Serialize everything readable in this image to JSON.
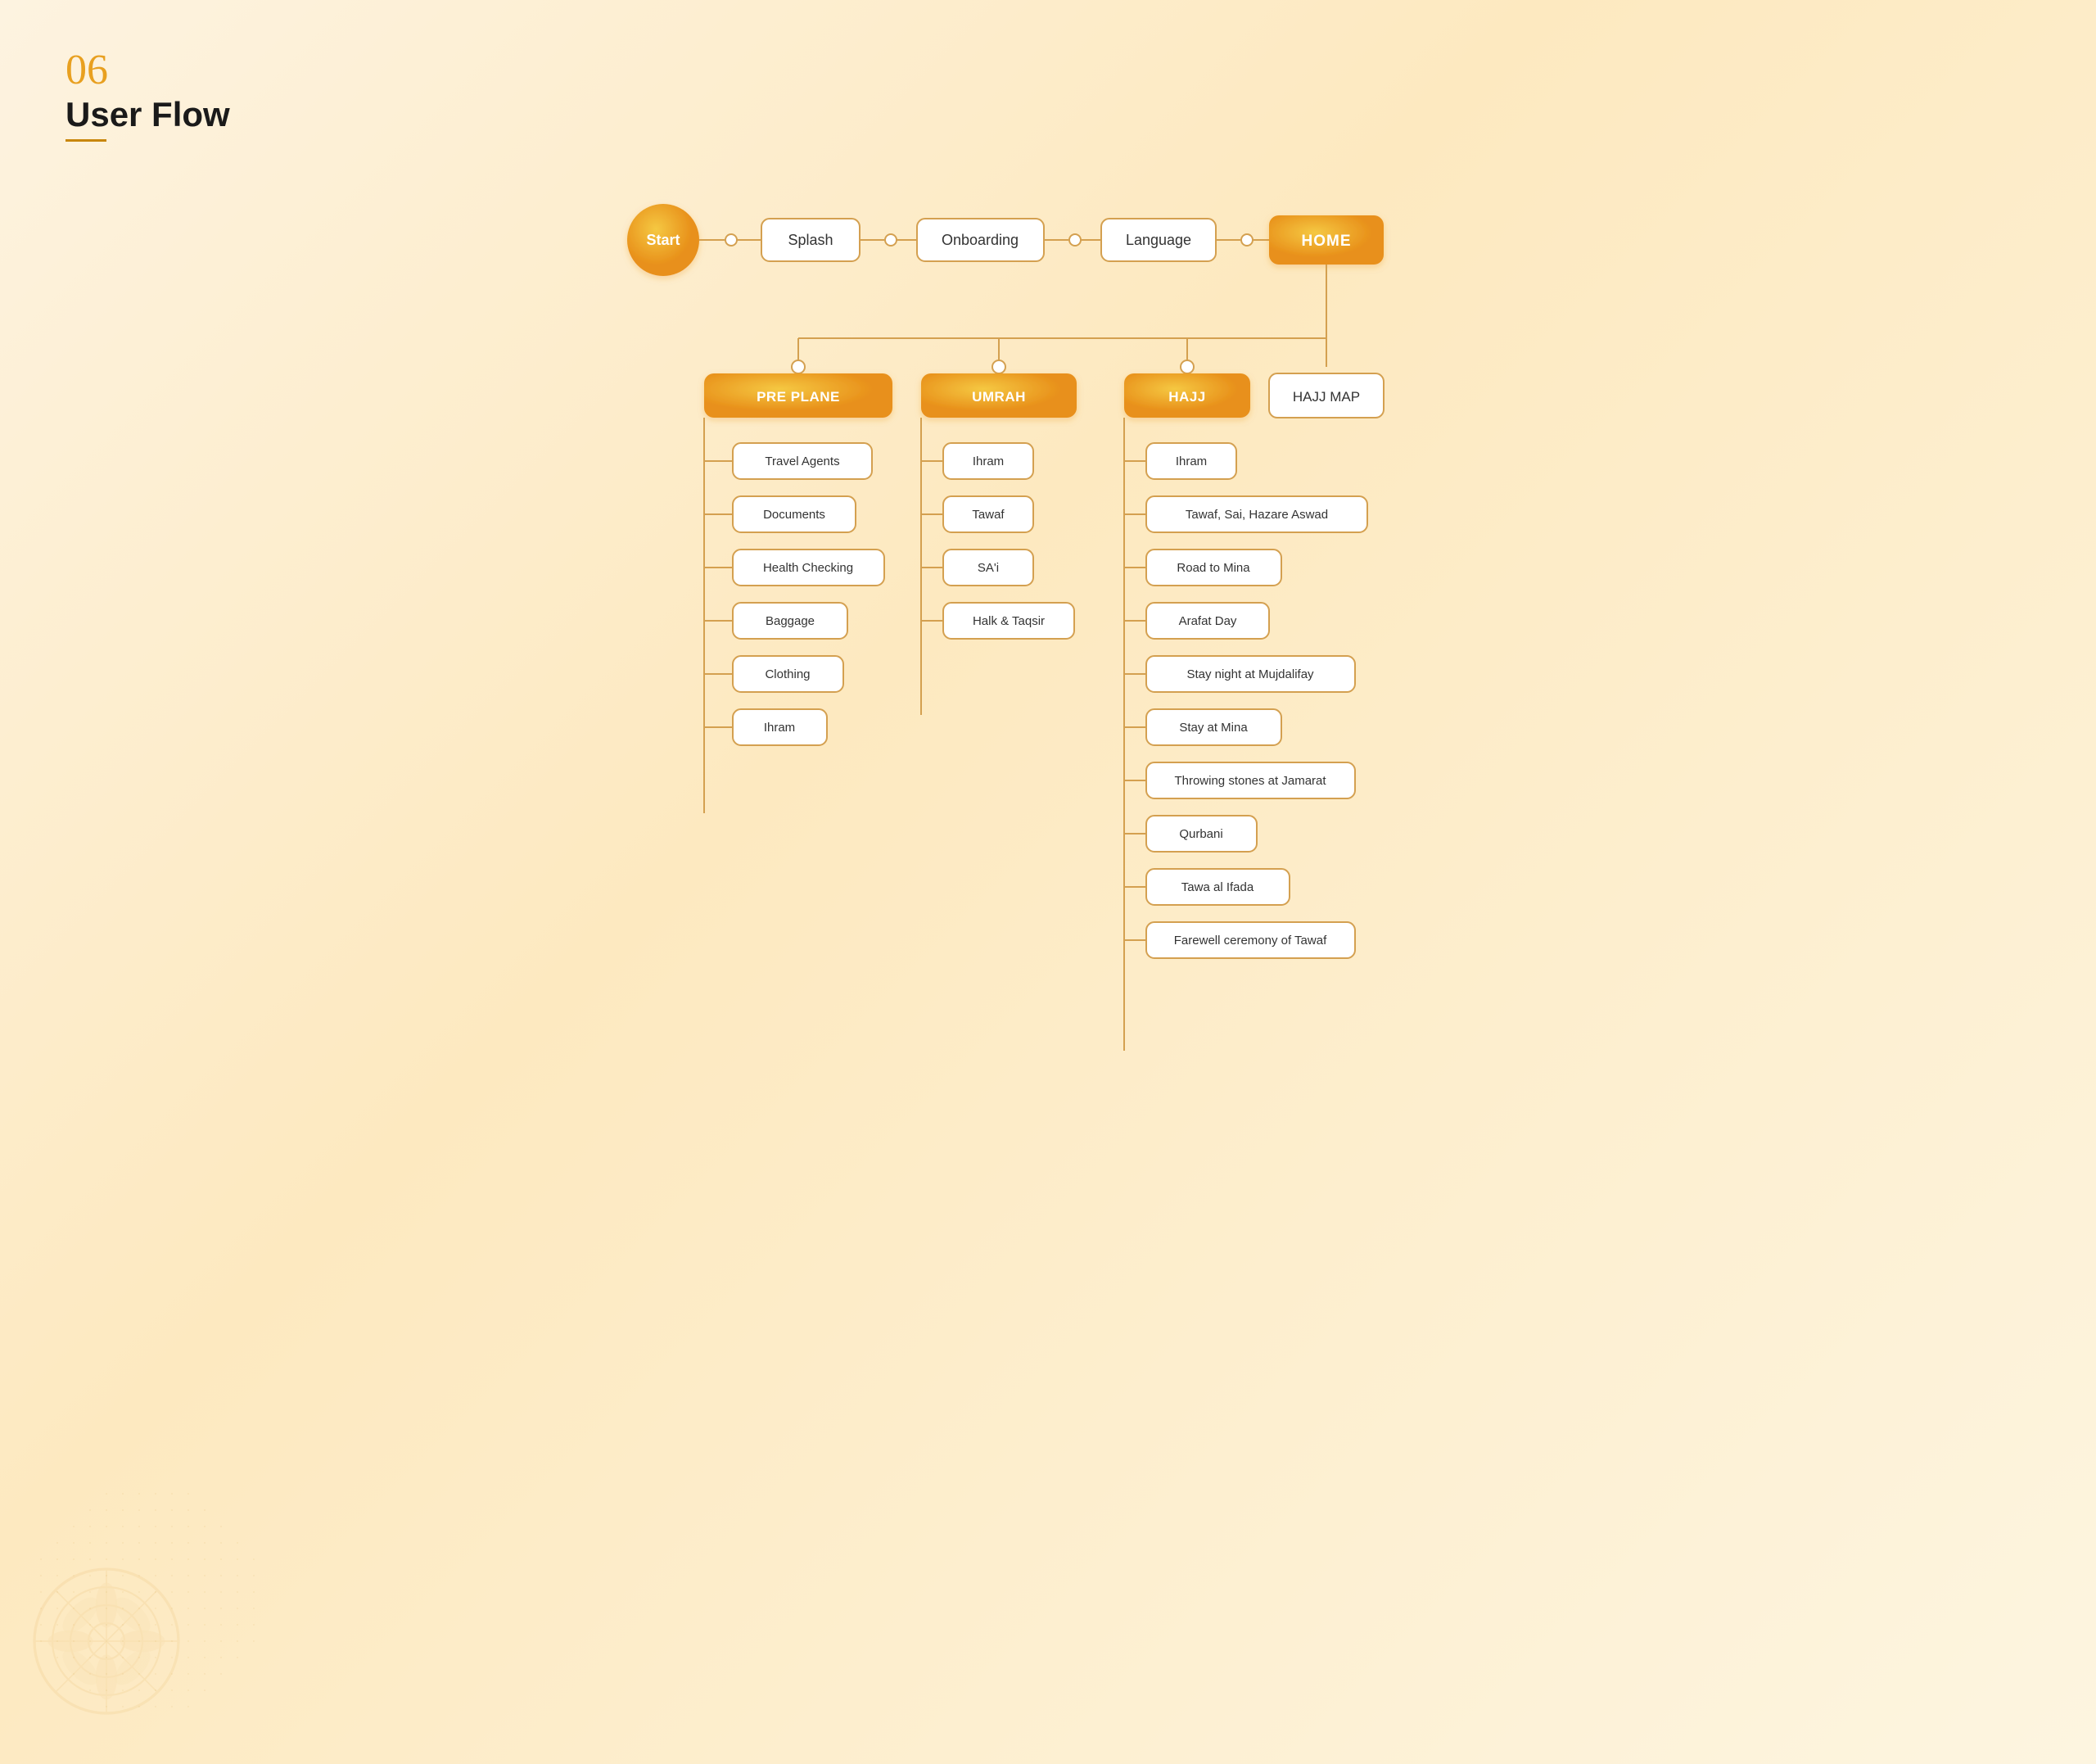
{
  "page": {
    "number": "06",
    "title": "User Flow",
    "underline_color": "#c8860a"
  },
  "colors": {
    "golden": "#e8901a",
    "golden_light": "#f5b942",
    "border": "#d4a050",
    "white": "#ffffff",
    "text_dark": "#1a1a1a",
    "text_body": "#333333"
  },
  "top_nodes": [
    {
      "id": "start",
      "label": "Start",
      "type": "circle_gold"
    },
    {
      "id": "splash",
      "label": "Splash",
      "type": "plain"
    },
    {
      "id": "onboarding",
      "label": "Onboarding",
      "type": "plain"
    },
    {
      "id": "language",
      "label": "Language",
      "type": "plain"
    },
    {
      "id": "home",
      "label": "HOME",
      "type": "gold"
    }
  ],
  "second_nodes": [
    {
      "id": "pre_plane",
      "label": "PRE PLANE",
      "type": "gold"
    },
    {
      "id": "umrah",
      "label": "UMRAH",
      "type": "gold"
    },
    {
      "id": "hajj",
      "label": "HAJJ",
      "type": "gold"
    },
    {
      "id": "hajj_map",
      "label": "HAJJ MAP",
      "type": "plain"
    }
  ],
  "pre_plane_children": [
    "Travel Agents",
    "Documents",
    "Health Checking",
    "Baggage",
    "Clothing",
    "Ihram"
  ],
  "umrah_children": [
    "Ihram",
    "Tawaf",
    "SA'i",
    "Halk & Taqsir"
  ],
  "hajj_children": [
    "Ihram",
    "Tawaf, Sai, Hazare Aswad",
    "Road to Mina",
    "Arafat Day",
    "Stay night at Mujdalifay",
    "Stay at Mina",
    "Throwing stones at Jamarat",
    "Qurbani",
    "Tawa al Ifada",
    "Farewell ceremony of Tawaf"
  ]
}
